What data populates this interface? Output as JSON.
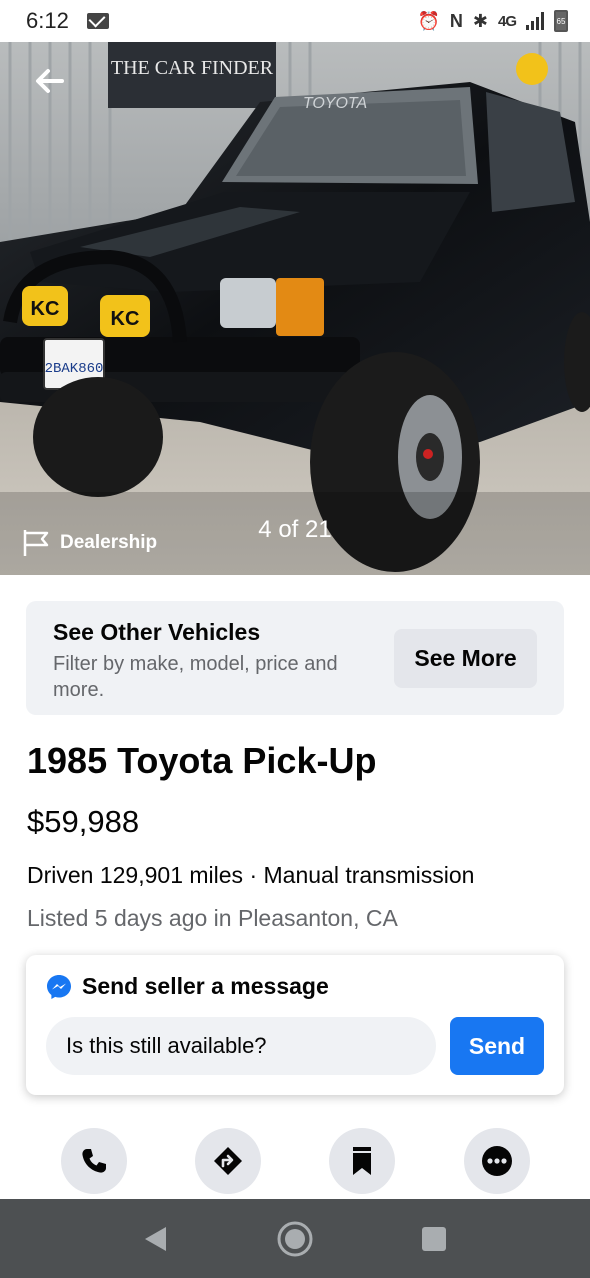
{
  "status_bar": {
    "time": "6:12",
    "network": "4G",
    "battery": "65",
    "icons": [
      "mail-icon",
      "alarm-icon",
      "nfc-icon",
      "bluetooth-icon",
      "signal-icon",
      "battery-icon"
    ]
  },
  "gallery": {
    "counter": "4 of 21",
    "seller_type": "Dealership",
    "photo_texts": {
      "dealer_sign": "THE CAR FINDER",
      "windshield": "TOYOTA",
      "plate": "2BAK860",
      "light_badge": "KC"
    }
  },
  "promo": {
    "title": "See Other Vehicles",
    "description": "Filter by make, model, price and more.",
    "button": "See More"
  },
  "listing": {
    "title": "1985 Toyota Pick-Up",
    "price": "$59,988",
    "specs": "Driven 129,901 miles · Manual transmission",
    "listed": "Listed 5 days ago in Pleasanton, CA"
  },
  "message": {
    "heading": "Send seller a message",
    "input_value": "Is this still available?",
    "send_label": "Send"
  },
  "actions": [
    "phone-icon",
    "directions-icon",
    "bookmark-icon",
    "more-icon"
  ],
  "colors": {
    "accent": "#1877f2",
    "secondary_text": "#65676b",
    "card_bg": "#f0f2f5",
    "nav_bar": "#4d5052"
  }
}
